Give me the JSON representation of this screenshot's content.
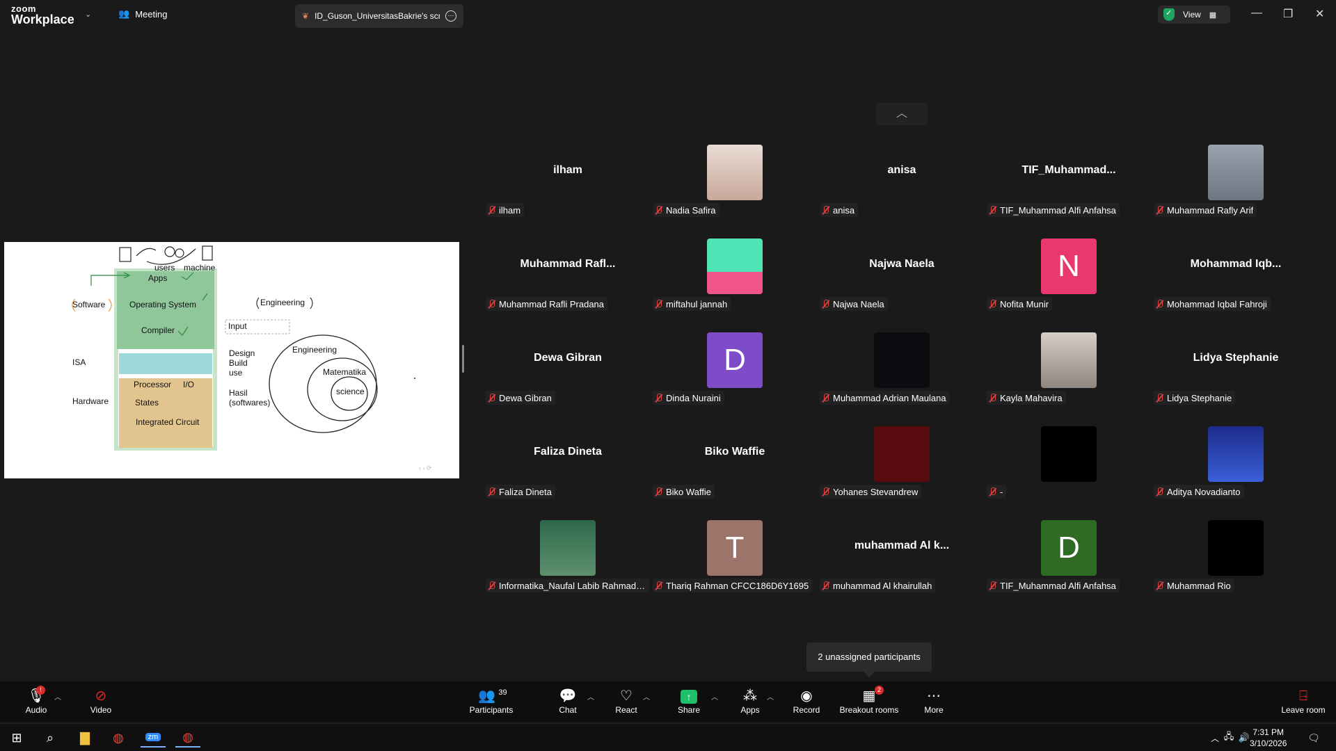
{
  "titlebar": {
    "brand_top": "zoom",
    "brand_bottom": "Workplace",
    "meeting_tab": "Meeting",
    "share_tab": "ID_Guson_UniversitasBakrie's scre",
    "view_label": "View"
  },
  "shared_screen": {
    "labels": {
      "users": "users",
      "machine": "machine",
      "apps": "Apps",
      "software": "Software",
      "os": "Operating System",
      "compiler": "Compiler",
      "isa": "ISA",
      "hardware": "Hardware",
      "processor": "Processor",
      "io": "I/O",
      "states": "States",
      "ic": "Integrated Circuit",
      "engineering_top": "Engineering",
      "input": "Input",
      "design": "Design",
      "build": "Build",
      "use": "use",
      "hasil": "Hasil",
      "softwares": "(softwares)",
      "engineering_circle": "Engineering",
      "matematika": "Matematika",
      "science": "science"
    }
  },
  "participants": [
    {
      "big": "ilham",
      "label": "ilham"
    },
    {
      "big": "",
      "label": "Nadia Safira",
      "thumb": "photo-woman"
    },
    {
      "big": "anisa",
      "label": "anisa"
    },
    {
      "big": "TIF_Muhammad...",
      "label": "TIF_Muhammad Alfi Anfahsa"
    },
    {
      "big": "",
      "label": "Muhammad Rafly Arif",
      "thumb": "photo-cat"
    },
    {
      "big": "Muhammad  Rafl...",
      "label": "Muhammad Rafli Pradana"
    },
    {
      "big": "",
      "label": "miftahul jannah",
      "thumb": "cupcake"
    },
    {
      "big": "Najwa Naela",
      "label": "Najwa Naela"
    },
    {
      "big": "",
      "label": "Nofita Munir",
      "initial": "N",
      "color": "#e8386d"
    },
    {
      "big": "Mohammad  Iqb...",
      "label": "Mohammad Iqbal Fahroji"
    },
    {
      "big": "Dewa Gibran",
      "label": "Dewa Gibran"
    },
    {
      "big": "",
      "label": "Dinda Nuraini",
      "initial": "D",
      "color": "#7e4bc9"
    },
    {
      "big": "",
      "label": "Muhammad Adrian Maulana",
      "thumb": "photo-dark"
    },
    {
      "big": "",
      "label": "Kayla Mahavira",
      "thumb": "photo-cats"
    },
    {
      "big": "Lidya Stephanie",
      "label": "Lidya Stephanie"
    },
    {
      "big": "Faliza Dineta",
      "label": "Faliza Dineta"
    },
    {
      "big": "Biko Waffie",
      "label": "Biko Waffie"
    },
    {
      "big": "",
      "label": "Yohanes Stevandrew",
      "thumb": "dark-red"
    },
    {
      "big": "",
      "label": "-",
      "thumb": "black"
    },
    {
      "big": "",
      "label": "Aditya Novadianto",
      "thumb": "astronaut"
    },
    {
      "big": "",
      "label": "Informatika_Naufal Labib Rahmada...",
      "thumb": "astronaut-green"
    },
    {
      "big": "",
      "label": "Thariq Rahman CFCC186D6Y1695",
      "initial": "T",
      "color": "#9c7469"
    },
    {
      "big": "muhammad Al k...",
      "label": "muhammad Al khairullah"
    },
    {
      "big": "",
      "label": "TIF_Muhammad Alfi Anfahsa",
      "initial": "D",
      "color": "#2f6b25"
    },
    {
      "big": "",
      "label": "Muhammad Rio",
      "thumb": "black"
    }
  ],
  "tooltip": "2 unassigned participants",
  "toolbar": {
    "audio": "Audio",
    "video": "Video",
    "participants": "Participants",
    "participants_count": "39",
    "chat": "Chat",
    "react": "React",
    "share": "Share",
    "apps": "Apps",
    "record": "Record",
    "breakout": "Breakout rooms",
    "breakout_badge": "2",
    "more": "More",
    "leave": "Leave room"
  },
  "taskbar": {
    "time": "7:31 PM",
    "date": "3/10/2026"
  },
  "colors": {
    "background": "#1a1a1a",
    "toolbar": "#0e0e0e",
    "share_green": "#1fbf6a",
    "muted_red": "#e04040"
  }
}
